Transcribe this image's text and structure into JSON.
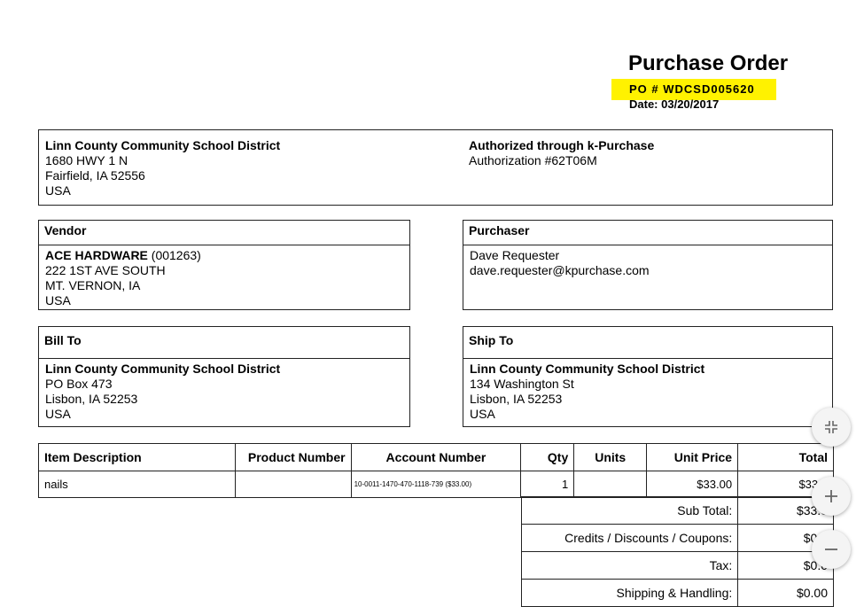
{
  "header": {
    "title": "Purchase Order",
    "po_number": "PO # WDCSD005620",
    "date": "Date: 03/20/2017",
    "highlight_color": "#fff200"
  },
  "district": {
    "name": "Linn County Community School District",
    "address1": "1680 HWY 1 N",
    "address2": "Fairfield, IA 52556",
    "country": "USA"
  },
  "authorization": {
    "title": "Authorized through k-Purchase",
    "number": "Authorization #62T06M"
  },
  "vendor": {
    "header": "Vendor",
    "name": "ACE HARDWARE",
    "code": " (001263)",
    "address1": "222 1ST AVE SOUTH",
    "address2": "MT. VERNON, IA",
    "country": "USA"
  },
  "purchaser": {
    "header": "Purchaser",
    "name": "Dave Requester",
    "email": "dave.requester@kpurchase.com"
  },
  "bill_to": {
    "header": "Bill To",
    "name": "Linn County Community School District",
    "address1": "PO Box 473",
    "address2": "Lisbon, IA 52253",
    "country": "USA"
  },
  "ship_to": {
    "header": "Ship To",
    "name": "Linn County Community School District",
    "address1": "134 Washington St",
    "address2": "Lisbon, IA 52253",
    "country": "USA"
  },
  "items_table": {
    "columns": [
      "Item Description",
      "Product Number",
      "Account Number",
      "Qty",
      "Units",
      "Unit Price",
      "Total"
    ],
    "rows": [
      {
        "description": "nails",
        "product_number": "",
        "account_number": "10-0011-1470-470-1118-739 ($33.00)",
        "qty": "1",
        "units": "",
        "unit_price": "$33.00",
        "total": "$33.0"
      }
    ]
  },
  "summary": [
    {
      "label": "Sub Total:",
      "value": "$33.0"
    },
    {
      "label": "Credits / Discounts / Coupons:",
      "value": "$0.0"
    },
    {
      "label": "Tax:",
      "value": "$0.0"
    },
    {
      "label": "Shipping & Handling:",
      "value": "$0.00"
    }
  ],
  "zoom_controls": {
    "fit_icon": "fit-page-icon",
    "zoom_in_icon": "zoom-in-icon",
    "zoom_out_icon": "zoom-out-icon"
  }
}
